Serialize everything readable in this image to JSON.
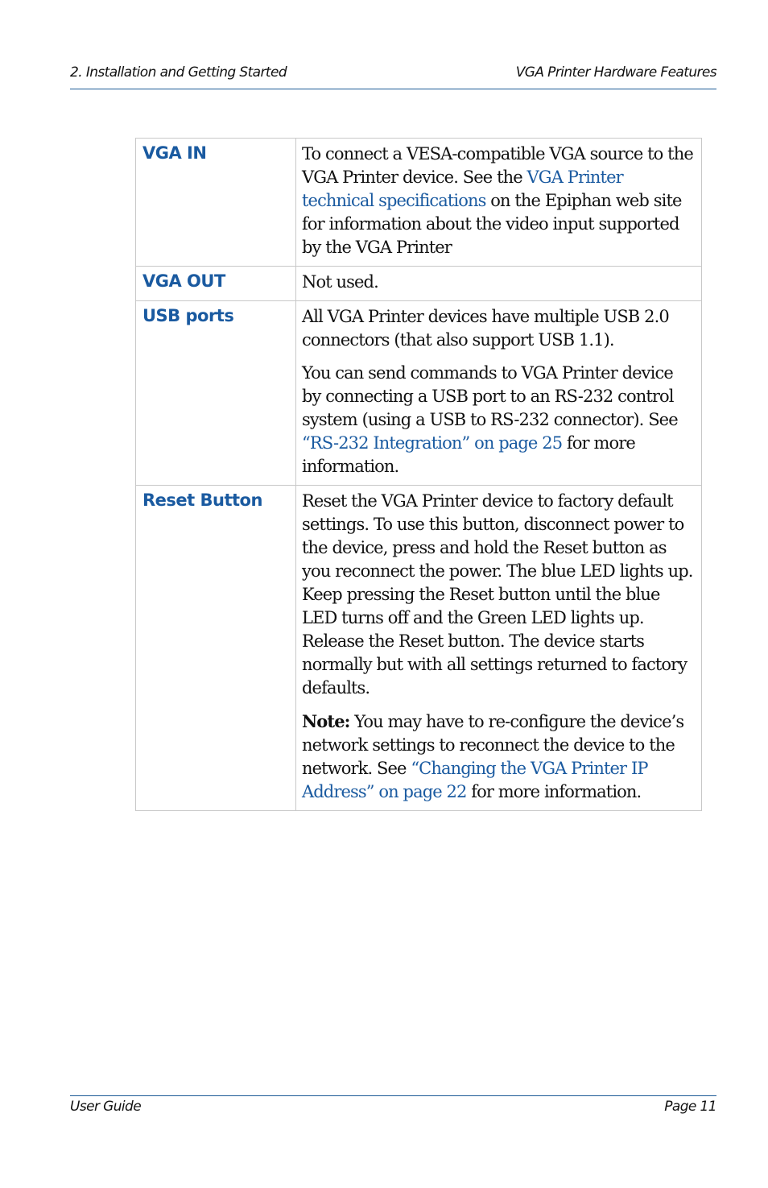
{
  "header": {
    "left": "2. Installation and Getting Started",
    "right": "VGA Printer Hardware Features"
  },
  "table": {
    "rows": [
      {
        "term": "VGA IN",
        "paragraphs": [
          {
            "before": "To connect a VESA-compatible VGA source to the VGA Printer device. See the ",
            "link": "VGA Printer technical specifications",
            "after": " on the Epiphan web site for information about the video input supported by the VGA Printer"
          }
        ]
      },
      {
        "term": "VGA OUT",
        "paragraphs": [
          {
            "text": "Not used."
          }
        ]
      },
      {
        "term": "USB ports",
        "paragraphs": [
          {
            "text": "All VGA Printer devices have multiple USB 2.0 connectors (that also support USB 1.1)."
          },
          {
            "before": "You can send commands to VGA Printer device by connecting a USB port to an RS-232 control system (using a USB to RS-232 connector). See ",
            "link": "“RS-232 Integration” on page 25",
            "after": " for more information."
          }
        ]
      },
      {
        "term": "Reset Button",
        "paragraphs": [
          {
            "text": "Reset the VGA Printer device to factory default settings. To use this button, disconnect power to the device, press and hold the Reset button as you reconnect the power. The blue LED lights up. Keep pressing the Reset button until the blue LED turns off and the Green LED lights up. Release the Reset button. The device starts normally but with all settings returned to factory defaults."
          },
          {
            "note_label": "Note:",
            "before": " You may have to re-configure the device’s network settings to reconnect the device to the network. See ",
            "link": "“Changing the VGA Printer IP Address” on page 22",
            "after": " for more information."
          }
        ]
      }
    ]
  },
  "footer": {
    "left": "User Guide",
    "right": "Page 11"
  },
  "colors": {
    "accent": "#1a5aa0",
    "rule": "#1c5a96",
    "table_border": "#c8c8c8"
  }
}
